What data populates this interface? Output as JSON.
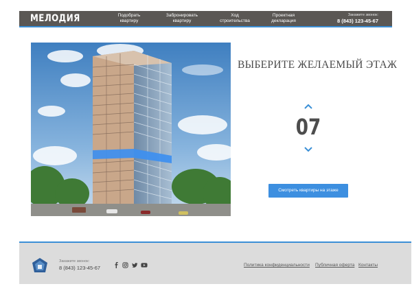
{
  "header": {
    "logo": "МЕЛОДИЯ",
    "nav": [
      {
        "line1": "Подобрать",
        "line2": "квартиру"
      },
      {
        "line1": "Забронировать",
        "line2": "квартиру"
      },
      {
        "line1": "Ход",
        "line2": "строительства"
      },
      {
        "line1": "Проектная",
        "line2": "декларация"
      }
    ],
    "call_label": "Закажите звонок:",
    "phone": "8 (843) 123-45-67"
  },
  "floor_picker": {
    "title": "ВЫБЕРИТЕ ЖЕЛАЕМЫЙ ЭТАЖ",
    "current_floor": "07",
    "button_label": "Смотреть квартиры на этаже"
  },
  "footer": {
    "call_label": "Закажите звонок:",
    "phone": "8 (843) 123-45-67",
    "social": [
      "facebook-icon",
      "instagram-icon",
      "twitter-icon",
      "youtube-icon"
    ],
    "links": [
      "Политика конфиденциальности",
      "Публичная оферта",
      "Контакты"
    ]
  },
  "colors": {
    "header_bg": "#5a5754",
    "accent": "#3a8fd6",
    "button": "#3d8fe0",
    "footer_bg": "#dcdcdc",
    "highlight_floor": "#3d8ff0"
  }
}
